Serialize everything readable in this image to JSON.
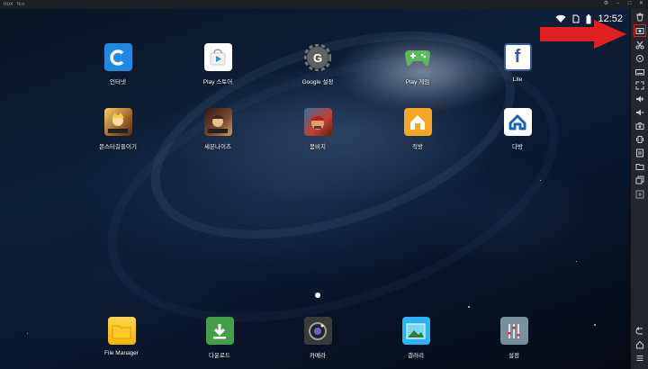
{
  "window": {
    "logo": "nox",
    "title": "Nox"
  },
  "status_bar": {
    "time": "12:52",
    "icons": [
      "wifi-icon",
      "battery-icon"
    ]
  },
  "apps": [
    {
      "label": "인터넷",
      "icon": "browser-icon",
      "color": "#1e88e5"
    },
    {
      "label": "Play 스토어",
      "icon": "play-store-icon",
      "color": "#ffffff"
    },
    {
      "label": "Google 설정",
      "icon": "google-settings-icon",
      "color": "#616161"
    },
    {
      "label": "Play 게임",
      "icon": "play-games-icon",
      "color": "#4caf50"
    },
    {
      "label": "Lite",
      "icon": "facebook-lite-icon",
      "color": "#3b5998"
    },
    {
      "label": "몬스터길들이기",
      "icon": "monster-taming-game-icon",
      "color": "#7a5a2a"
    },
    {
      "label": "세븐나이츠",
      "icon": "seven-knights-game-icon",
      "color": "#5a3a2a"
    },
    {
      "label": "붐비치",
      "icon": "boom-beach-game-icon",
      "color": "#8b3a2a"
    },
    {
      "label": "직방",
      "icon": "zigbang-icon",
      "color": "#f5a623"
    },
    {
      "label": "다방",
      "icon": "dabang-icon",
      "color": "#ffffff"
    }
  ],
  "dock": [
    {
      "label": "File Manager",
      "icon": "folder-icon",
      "color": "#f4b400"
    },
    {
      "label": "다운로드",
      "icon": "download-icon",
      "color": "#43a047"
    },
    {
      "label": "카메라",
      "icon": "camera-icon",
      "color": "#424242"
    },
    {
      "label": "갤러리",
      "icon": "gallery-icon",
      "color": "#4fc3f7"
    },
    {
      "label": "설정",
      "icon": "settings-sliders-icon",
      "color": "#90a4ae"
    }
  ],
  "toolbar": {
    "items": [
      "trash-icon",
      "screenshot-icon",
      "scissors-icon",
      "location-icon",
      "keyboard-icon",
      "fullscreen-icon",
      "volume-up-icon",
      "volume-down-icon",
      "camera-icon",
      "shake-icon",
      "apk-icon",
      "folder-icon",
      "files-icon",
      "add-icon"
    ],
    "bottom": [
      "back-icon",
      "home-icon",
      "menu-icon"
    ],
    "highlighted": "screenshot-icon"
  },
  "colors": {
    "annotation": "#e02020",
    "toolbar_bg": "#23272d",
    "titlebar_bg": "#1c1f24"
  }
}
